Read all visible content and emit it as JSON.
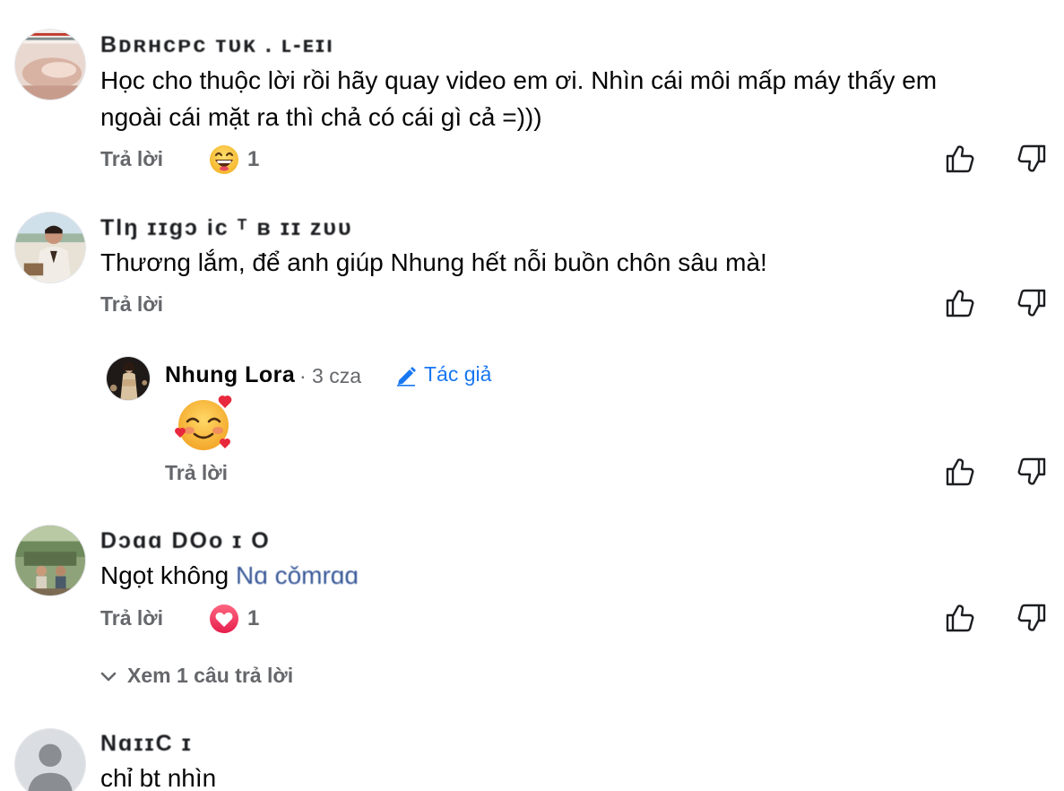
{
  "comments": [
    {
      "author": "Bᴅʀʜᴄᴘᴄ ᴛᴜᴋ . ʟ-ᴇɪı",
      "text_line1": "Học cho thuộc lời rồi hãy quay video em ơi. Nhìn cái môi mấp máy thấy em",
      "text_line2": "ngoài cái mặt ra thì chả có cái gì cả =)))",
      "reply_label": "Trả lời",
      "reaction_icon": "haha-emoji",
      "reaction_count": "1"
    },
    {
      "author": "Tlŋ ɪɪgɔ ic ᵀ ʙ ɪɪ ᴢᴜᴜ",
      "text": "Thương lắm, để anh giúp Nhung hết nỗi buồn chôn sâu mà!",
      "reply_label": "Trả lời",
      "reply": {
        "author": "Nhung Lora",
        "meta": "· 3 cza",
        "author_badge_icon": "pencil-icon",
        "author_badge": "Tác giả",
        "emoji": "smiling-face-with-hearts",
        "reply_label": "Trả lời"
      }
    },
    {
      "author": "Dɔɑɑ DOo ɪ O",
      "text": "Ngọt không",
      "mention": "Nɑ    cǒmrɑɑ",
      "reply_label": "Trả lời",
      "reaction_icon": "love-heart",
      "reaction_count": "1",
      "see_replies": "Xem 1 câu trả lời"
    },
    {
      "author": "NɑɪɪC ɪ",
      "text": "chỉ bt nhìn"
    }
  ],
  "icons": {
    "like": "thumbs-up-icon",
    "dislike": "thumbs-down-icon",
    "expand": "chevron-down-icon"
  },
  "colors": {
    "secondary_text": "#65676b",
    "accent": "#1877f2"
  }
}
